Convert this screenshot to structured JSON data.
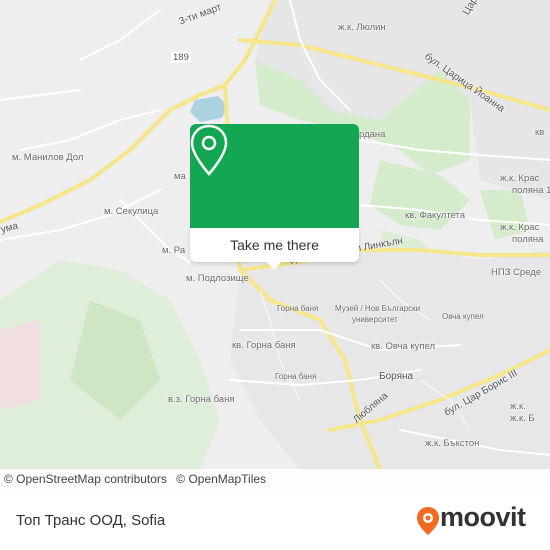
{
  "map": {
    "place_labels": [
      {
        "id": "lyulin",
        "text": "ж.к. Люлин"
      },
      {
        "id": "manilov",
        "text": "м. Манилов Дол"
      },
      {
        "id": "sekulitsa",
        "text": "м. Секулица"
      },
      {
        "id": "podlozishte",
        "text": "м. Подлозище"
      },
      {
        "id": "rad",
        "text": "м. Ра"
      },
      {
        "id": "fakulteta",
        "text": "кв. Факултета"
      },
      {
        "id": "krasna1",
        "text": "ж.к. Крас"
      },
      {
        "id": "polyana1",
        "text": "поляна 1"
      },
      {
        "id": "krasna2",
        "text": "ж.к. Крас"
      },
      {
        "id": "polyana2",
        "text": "поляна"
      },
      {
        "id": "nps",
        "text": "НПЗ Среде"
      },
      {
        "id": "gorna1",
        "text": "Горна баня"
      },
      {
        "id": "gorna_kv",
        "text": "кв. Горна баня"
      },
      {
        "id": "gorna2",
        "text": "Горна баня"
      },
      {
        "id": "vz_gorna",
        "text": "в.з. Горна баня"
      },
      {
        "id": "ovcha_kv",
        "text": "кв. Овча купел"
      },
      {
        "id": "ovcha",
        "text": "Овча купел"
      },
      {
        "id": "muzei1",
        "text": "Музей / Нов Български"
      },
      {
        "id": "muzei2",
        "text": "университет"
      },
      {
        "id": "boryana",
        "text": "Боряна"
      },
      {
        "id": "lyublyana",
        "text": "Любляна"
      },
      {
        "id": "bakston",
        "text": "ж.к. Бъкстон"
      },
      {
        "id": "zhk_right",
        "text": "ж.к."
      },
      {
        "id": "zhk_right2",
        "text": "ж.к. Б"
      },
      {
        "id": "dana",
        "text": "рдана"
      },
      {
        "id": "ma",
        "text": "ма"
      },
      {
        "id": "umak",
        "text": "ума"
      },
      {
        "id": "mrt",
        "text": "3-ти март"
      },
      {
        "id": "tsaritsa",
        "text": "бул. Царица Йоанна"
      },
      {
        "id": "tsaritsa2",
        "text": "Царица"
      },
      {
        "id": "linkoln",
        "text": "ам Линкълн"
      },
      {
        "id": "bul",
        "text": "бул."
      },
      {
        "id": "boris",
        "text": "бул. Цар Борис III"
      },
      {
        "id": "kv_right",
        "text": "кв"
      }
    ],
    "shield_189": "189"
  },
  "popup": {
    "label": "Take me there",
    "color": "#13a753"
  },
  "attribution": {
    "osm": "© OpenStreetMap contributors",
    "omt": "© OpenMapTiles"
  },
  "footer": {
    "title": "Топ Транс ООД, Sofia",
    "brand": "moovit",
    "brand_color": "#f26b21"
  }
}
